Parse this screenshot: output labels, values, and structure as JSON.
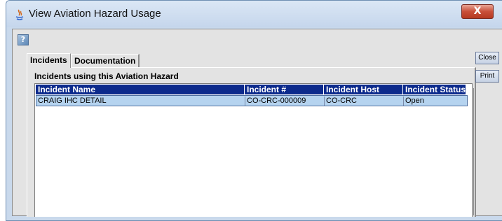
{
  "window": {
    "title": "View Aviation Hazard Usage",
    "close_glyph": "X"
  },
  "toolbar": {
    "help_glyph": "?"
  },
  "tabs": [
    {
      "label": "Incidents"
    },
    {
      "label": "Documentation"
    }
  ],
  "panel": {
    "section_label": "Incidents using this Aviation Hazard"
  },
  "table": {
    "columns": [
      "Incident Name",
      "Incident #",
      "Incident Host",
      "Incident Status"
    ],
    "rows": [
      [
        "CRAIG IHC DETAIL",
        "CO-CRC-000009",
        "CO-CRC",
        "Open"
      ]
    ]
  },
  "side_buttons": {
    "close": "Close",
    "print": "Print"
  }
}
